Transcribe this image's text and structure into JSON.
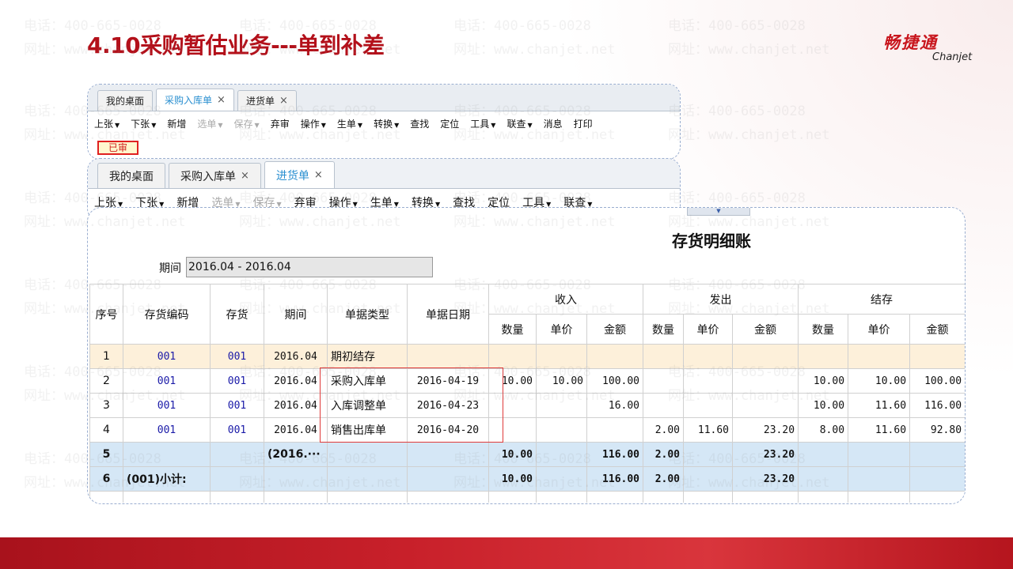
{
  "slide": {
    "title": "4.10采购暂估业务---单到补差",
    "logo_cn": "畅捷通",
    "logo_en": "Chanjet",
    "watermark_phone": "电话：400-665-0028",
    "watermark_site": "网址：www.chanjet.net",
    "brand_color": "#b3101a"
  },
  "window1": {
    "tabs": [
      {
        "label": "我的桌面",
        "closable": false
      },
      {
        "label": "采购入库单",
        "closable": true,
        "active": true
      },
      {
        "label": "进货单",
        "closable": true
      }
    ],
    "toolbar": {
      "prev": "上张",
      "next": "下张",
      "new": "新增",
      "select": "选单",
      "save": "保存",
      "abandon": "弃审",
      "operate": "操作",
      "generate": "生单",
      "convert": "转换",
      "find": "查找",
      "locate": "定位",
      "tools": "工具",
      "linked": "联查",
      "message": "消息",
      "print": "打印"
    },
    "status_stamp": "已审"
  },
  "window2": {
    "tabs": [
      {
        "label": "我的桌面",
        "closable": false
      },
      {
        "label": "采购入库单",
        "closable": true
      },
      {
        "label": "进货单",
        "closable": true,
        "active": true
      }
    ],
    "toolbar": {
      "prev": "上张",
      "next": "下张",
      "new": "新增",
      "select": "选单",
      "save": "保存",
      "abandon": "弃审",
      "operate": "操作",
      "generate": "生单",
      "convert": "转换",
      "find": "查找",
      "locate": "定位",
      "tools": "工具",
      "linked": "联查"
    }
  },
  "ledger": {
    "title": "存货明细账",
    "period_label": "期间",
    "period_value": "2016.04 - 2016.04",
    "headers": {
      "seq": "序号",
      "code": "存货编码",
      "item": "存货",
      "period": "期间",
      "doc_type": "单据类型",
      "doc_date": "单据日期",
      "income": "收入",
      "issue": "发出",
      "balance": "结存",
      "qty": "数量",
      "price": "单价",
      "amount": "金额"
    },
    "rows": [
      {
        "seq": "1",
        "code": "001",
        "item": "001",
        "period": "2016.04",
        "doc_type": "期初结存",
        "doc_date": "",
        "in_qty": "",
        "in_price": "",
        "in_amt": "",
        "out_qty": "",
        "out_price": "",
        "out_amt": "",
        "bal_qty": "",
        "bal_price": "",
        "bal_amt": "",
        "kind": "opening"
      },
      {
        "seq": "2",
        "code": "001",
        "item": "001",
        "period": "2016.04",
        "doc_type": "采购入库单",
        "doc_date": "2016-04-19",
        "in_qty": "10.00",
        "in_price": "10.00",
        "in_amt": "100.00",
        "out_qty": "",
        "out_price": "",
        "out_amt": "",
        "bal_qty": "10.00",
        "bal_price": "10.00",
        "bal_amt": "100.00",
        "kind": "normal"
      },
      {
        "seq": "3",
        "code": "001",
        "item": "001",
        "period": "2016.04",
        "doc_type": "入库调整单",
        "doc_date": "2016-04-23",
        "in_qty": "",
        "in_price": "",
        "in_amt": "16.00",
        "out_qty": "",
        "out_price": "",
        "out_amt": "",
        "bal_qty": "10.00",
        "bal_price": "11.60",
        "bal_amt": "116.00",
        "kind": "normal"
      },
      {
        "seq": "4",
        "code": "001",
        "item": "001",
        "period": "2016.04",
        "doc_type": "销售出库单",
        "doc_date": "2016-04-20",
        "in_qty": "",
        "in_price": "",
        "in_amt": "",
        "out_qty": "2.00",
        "out_price": "11.60",
        "out_amt": "23.20",
        "bal_qty": "8.00",
        "bal_price": "11.60",
        "bal_amt": "92.80",
        "kind": "normal"
      },
      {
        "seq": "5",
        "code": "",
        "item": "",
        "period": "(2016.···",
        "doc_type": "",
        "doc_date": "",
        "in_qty": "10.00",
        "in_price": "",
        "in_amt": "116.00",
        "out_qty": "2.00",
        "out_price": "",
        "out_amt": "23.20",
        "bal_qty": "",
        "bal_price": "",
        "bal_amt": "",
        "kind": "subtotal"
      },
      {
        "seq": "6",
        "code": "(001)小计:",
        "item": "",
        "period": "",
        "doc_type": "",
        "doc_date": "",
        "in_qty": "10.00",
        "in_price": "",
        "in_amt": "116.00",
        "out_qty": "2.00",
        "out_price": "",
        "out_amt": "23.20",
        "bal_qty": "",
        "bal_price": "",
        "bal_amt": "",
        "kind": "subtotal"
      }
    ]
  }
}
